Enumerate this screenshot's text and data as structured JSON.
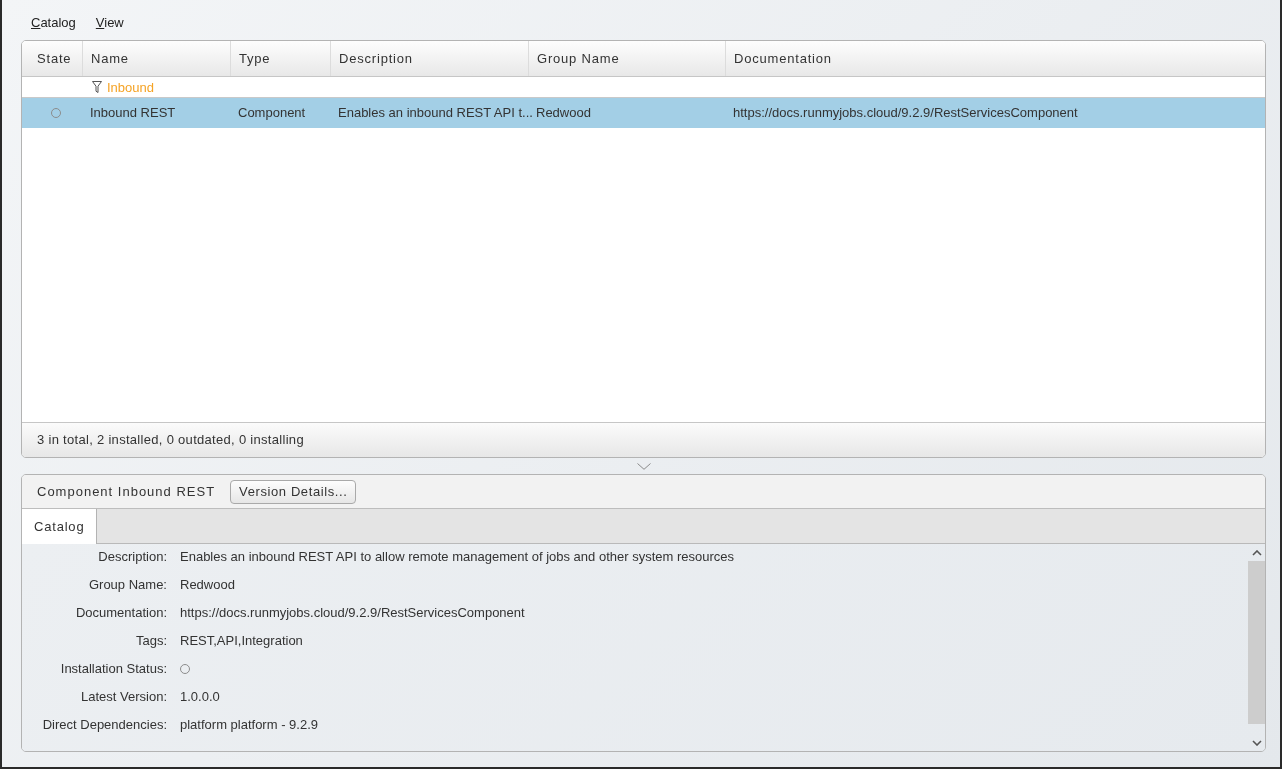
{
  "menu": [
    {
      "label": "Catalog"
    },
    {
      "label": "View"
    }
  ],
  "table": {
    "columns": [
      "State",
      "Name",
      "Type",
      "Description",
      "Group Name",
      "Documentation"
    ],
    "filter": {
      "text": "Inbound"
    },
    "rows": [
      {
        "installed": false,
        "name": "Inbound REST",
        "type": "Component",
        "description": "Enables an inbound REST API t...",
        "group_name": "Redwood",
        "documentation": "https://docs.runmyjobs.cloud/9.2.9/RestServicesComponent",
        "selected": true
      }
    ]
  },
  "status_bar": "3 in total, 2 installed, 0 outdated, 0 installing",
  "details": {
    "title": "Component Inbound REST",
    "button": "Version Details...",
    "tabs": [
      {
        "label": "Catalog",
        "selected": true
      }
    ],
    "properties": [
      {
        "kind": "text",
        "label": "Description:",
        "value": "Enables an inbound REST API to allow remote management of jobs and other system resources"
      },
      {
        "kind": "text",
        "label": "Group Name:",
        "value": "Redwood"
      },
      {
        "kind": "text",
        "label": "Documentation:",
        "value": "https://docs.runmyjobs.cloud/9.2.9/RestServicesComponent"
      },
      {
        "kind": "text",
        "label": "Tags:",
        "value": "REST,API,Integration"
      },
      {
        "kind": "status",
        "label": "Installation Status:",
        "installed": false
      },
      {
        "kind": "text",
        "label": "Latest Version:",
        "value": "1.0.0.0"
      },
      {
        "kind": "text",
        "label": "Direct Dependencies:",
        "value": "platform platform - 9.2.9"
      }
    ]
  }
}
